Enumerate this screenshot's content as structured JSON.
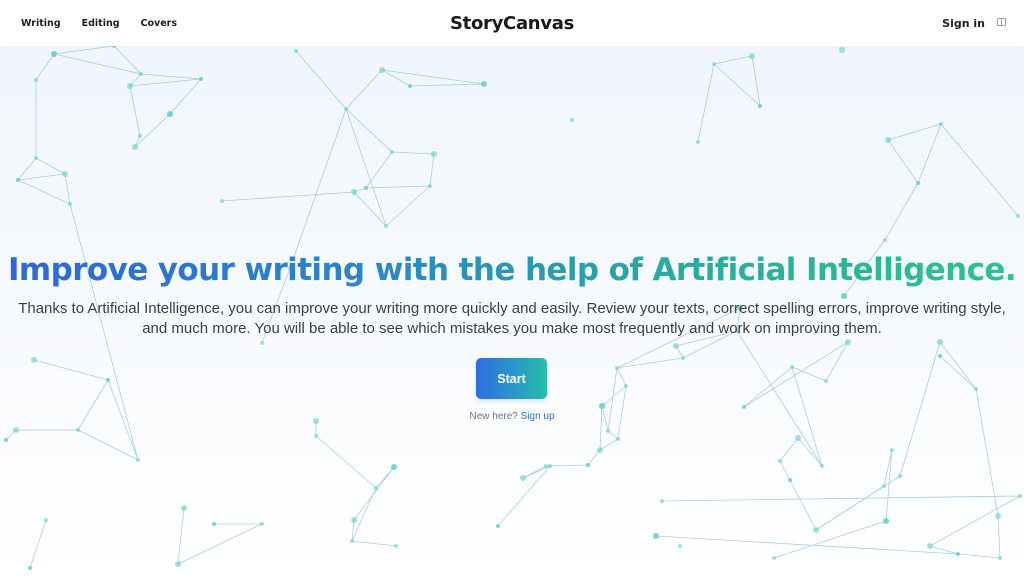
{
  "nav": {
    "links": [
      "Writing",
      "Editing",
      "Covers"
    ],
    "brand": "StoryCanvas",
    "signin": "Sign in",
    "language_icon": "flag-icon"
  },
  "hero": {
    "headline": "Improve your writing with the help of Artificial Intelligence.",
    "subtext_line1": "Thanks to Artificial Intelligence, you can improve your writing more quickly and easily. Review your texts, correct spelling errors, improve writing style,",
    "subtext_line2": "and much more. You will be able to see which mistakes you make most frequently and work on improving them.",
    "cta_label": "Start",
    "new_here": "New here?",
    "signup_label": "Sign up"
  },
  "colors": {
    "headline_gradient_start": "#2f66d8",
    "headline_gradient_end": "#2cc48a",
    "network_line": "#7fb6d9",
    "network_node": "#5fd0c8",
    "link": "#2b6fd6"
  },
  "background_decoration": "network-particles"
}
